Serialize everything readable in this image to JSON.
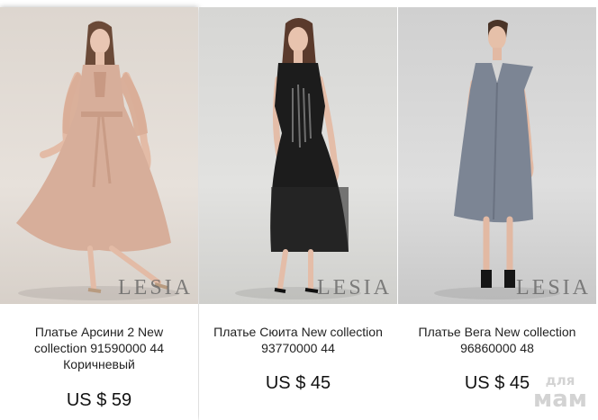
{
  "products": [
    {
      "title": "Платье Арсини 2 New collection 91590000 44 Коричневый",
      "price": "US $ 59",
      "brand": "LESIA",
      "dress_color": "#d7ae9a"
    },
    {
      "title": "Платье Сюита New collection 93770000 44",
      "price": "US $ 45",
      "brand": "LESIA",
      "dress_color": "#1c1c1c"
    },
    {
      "title": "Платье Вега New collection 96860000 48",
      "price": "US $ 45",
      "brand": "LESIA",
      "dress_color": "#7c8594"
    }
  ],
  "watermark": {
    "line1": "для",
    "line2": "мам"
  }
}
